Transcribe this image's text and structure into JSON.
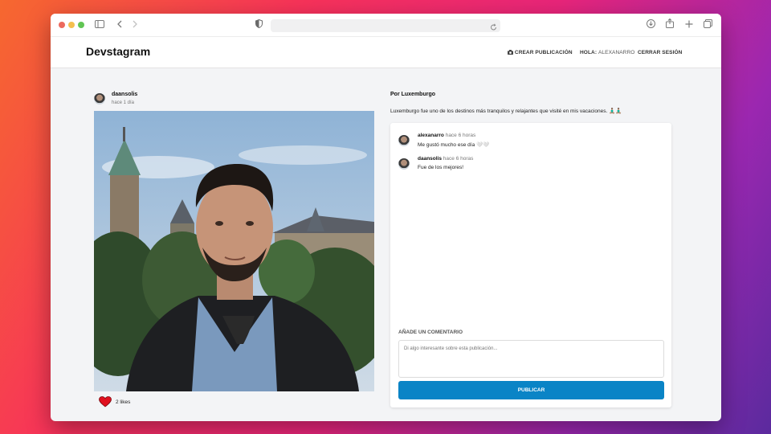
{
  "browser": {
    "icons": [
      "sidebar-icon",
      "back-icon",
      "forward-icon",
      "shield-icon",
      "reload-icon",
      "download-icon",
      "share-icon",
      "new-tab-icon",
      "tabs-icon"
    ]
  },
  "app": {
    "logo": "Devstagram",
    "nav": {
      "create_post": "Crear publicación",
      "hello_label": "Hola:",
      "username": "alexanarro",
      "logout": "Cerrar sesión"
    }
  },
  "post": {
    "author": "daansolis",
    "time": "hace 1 día",
    "likes": "2 likes",
    "title": "Por Luxemburgo",
    "description": "Luxemburgo fue uno de los destinos más tranquilos y relajantes que visité en mis vacaciones. 🧘🏽‍♂️🧘🏽‍♂️"
  },
  "comments": [
    {
      "user": "alexanarro",
      "time": "hace 6 horas",
      "text": "Me gustó mucho ese día 🤍🤍"
    },
    {
      "user": "daansolis",
      "time": "hace 6 horas",
      "text": "Fue de los mejores!"
    }
  ],
  "comment_form": {
    "label": "Añade un comentario",
    "placeholder": "Di algo interesante sobre esta publicación...",
    "submit": "Publicar"
  },
  "colors": {
    "accent": "#0a84c6",
    "heart": "#e0101e"
  }
}
